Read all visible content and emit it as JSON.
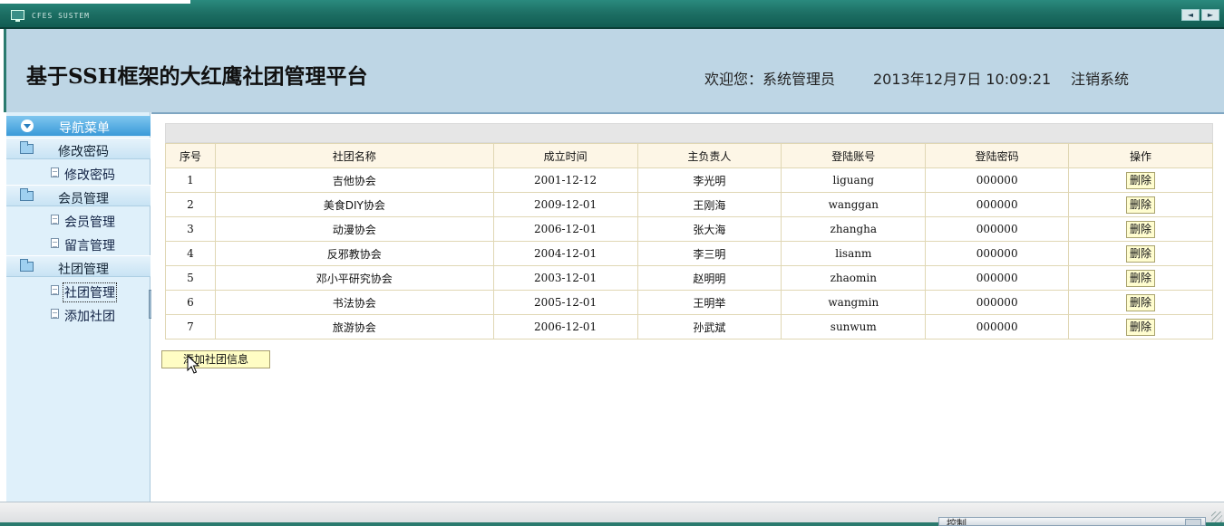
{
  "window": {
    "title": "CFES SUSTEM",
    "arrow_left": "◄",
    "arrow_right": "►"
  },
  "header": {
    "app_title": "基于SSH框架的大红鹰社团管理平台",
    "welcome": "欢迎您：系统管理员",
    "datetime": "2013年12月7日  10:09:21",
    "logout": "注销系统"
  },
  "sidebar": {
    "nav_title": "导航菜单",
    "groups": [
      {
        "label": "修改密码",
        "items": [
          {
            "label": "修改密码"
          }
        ]
      },
      {
        "label": "会员管理",
        "items": [
          {
            "label": "会员管理"
          },
          {
            "label": "留言管理"
          }
        ]
      },
      {
        "label": "社团管理",
        "items": [
          {
            "label": "社团管理"
          },
          {
            "label": "添加社团"
          }
        ]
      }
    ],
    "active_item": "社团管理"
  },
  "table": {
    "columns": [
      "序号",
      "社团名称",
      "成立时间",
      "主负责人",
      "登陆账号",
      "登陆密码",
      "操作"
    ],
    "rows": [
      {
        "no": "1",
        "name": "吉他协会",
        "founded": "2001-12-12",
        "leader": "李光明",
        "account": "liguang",
        "password": "000000",
        "action": "删除"
      },
      {
        "no": "2",
        "name": "美食DIY协会",
        "founded": "2009-12-01",
        "leader": "王刚海",
        "account": "wanggan",
        "password": "000000",
        "action": "删除"
      },
      {
        "no": "3",
        "name": "动漫协会",
        "founded": "2006-12-01",
        "leader": "张大海",
        "account": "zhangha",
        "password": "000000",
        "action": "删除"
      },
      {
        "no": "4",
        "name": "反邪教协会",
        "founded": "2004-12-01",
        "leader": "李三明",
        "account": "lisanm",
        "password": "000000",
        "action": "删除"
      },
      {
        "no": "5",
        "name": "邓小平研究协会",
        "founded": "2003-12-01",
        "leader": "赵明明",
        "account": "zhaomin",
        "password": "000000",
        "action": "删除"
      },
      {
        "no": "6",
        "name": "书法协会",
        "founded": "2005-12-01",
        "leader": "王明举",
        "account": "wangmin",
        "password": "000000",
        "action": "删除"
      },
      {
        "no": "7",
        "name": "旅游协会",
        "founded": "2006-12-01",
        "leader": "孙武斌",
        "account": "sunwum",
        "password": "000000",
        "action": "删除"
      }
    ]
  },
  "add_button": "添加社团信息",
  "status": {
    "control_label": "控制"
  },
  "colors": {
    "title_bar": "#1d6f64",
    "header_bg": "#bed6e5",
    "sidebar_bg": "#dff0fa",
    "table_header_bg": "#fdf6e6",
    "button_bg": "#fffdc4"
  }
}
